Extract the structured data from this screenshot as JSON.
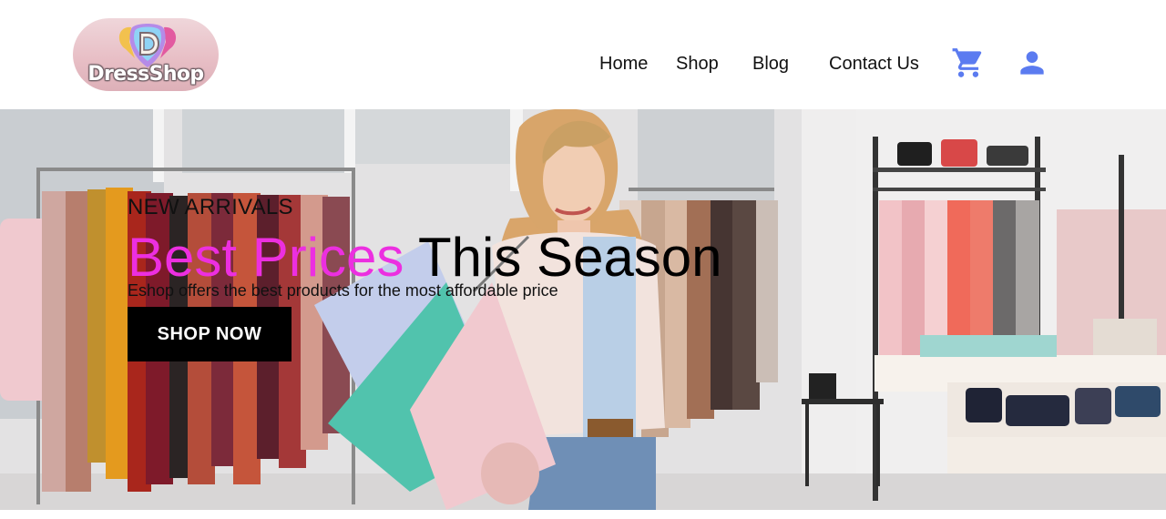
{
  "brand": {
    "logo_text": "DressShop",
    "logo_mark": "D"
  },
  "nav": {
    "items": [
      {
        "label": "Home"
      },
      {
        "label": "Shop"
      },
      {
        "label": "Blog"
      },
      {
        "label": "Contact Us"
      }
    ]
  },
  "icons": {
    "cart": "shopping-cart-icon",
    "user": "user-account-icon",
    "accent_color": "#5b7bf0"
  },
  "hero": {
    "eyebrow": "NEW ARRIVALS",
    "headline_highlight": "Best Prices",
    "headline_rest": "This Season",
    "subtitle": "Eshop offers the best products for the most affordable price",
    "cta_label": "SHOP NOW",
    "highlight_color": "#ec2fe0"
  }
}
